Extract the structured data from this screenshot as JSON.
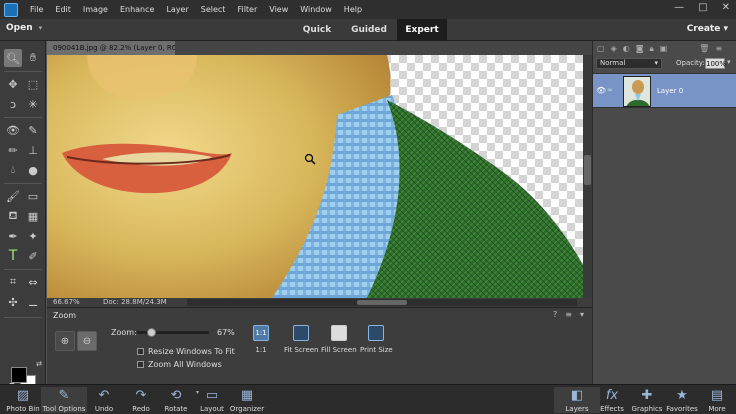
{
  "menu": [
    "File",
    "Edit",
    "Image",
    "Enhance",
    "Layer",
    "Select",
    "Filter",
    "View",
    "Window",
    "Help"
  ],
  "window_controls": {
    "minimize": "—",
    "maximize": "□",
    "close": "✕"
  },
  "modes": {
    "open": "Open",
    "quick": "Quick",
    "guided": "Guided",
    "expert": "Expert",
    "create": "Create"
  },
  "document": {
    "tab": "090041B.jpg @ 82.2% (Layer 0, RGB/8) *",
    "close": "×"
  },
  "status": {
    "zoom": "66.67%",
    "doc": "Doc: 28.8M/24.3M"
  },
  "tool_options": {
    "title": "Zoom",
    "zoom_label": "Zoom:",
    "zoom_value": "67%",
    "zoom_level": 0.2,
    "resize_windows": "Resize Windows To Fit",
    "zoom_all_windows": "Zoom All Windows",
    "one_to_one": "1:1",
    "fit_screen": "Fit Screen",
    "fill_screen": "Fill Screen",
    "print_size": "Print Size",
    "help": "?",
    "menu": "≡"
  },
  "layers_panel": {
    "blend_mode": "Normal",
    "opacity_label": "Opacity:",
    "opacity_value": "100%",
    "layer_name": "Layer 0"
  },
  "taskbar": {
    "photo_bin": "Photo Bin",
    "tool_options": "Tool Options",
    "undo": "Undo",
    "redo": "Redo",
    "rotate": "Rotate",
    "layout": "Layout",
    "organizer": "Organizer",
    "layers": "Layers",
    "effects": "Effects",
    "graphics": "Graphics",
    "favorites": "Favorites",
    "more": "More"
  },
  "colors": {
    "accent": "#7894c6",
    "expert_bg": "#1d1d1d",
    "skin": "#d9b85c",
    "jacket": "#2e6a2b",
    "shirt": "#8fc6e8"
  }
}
